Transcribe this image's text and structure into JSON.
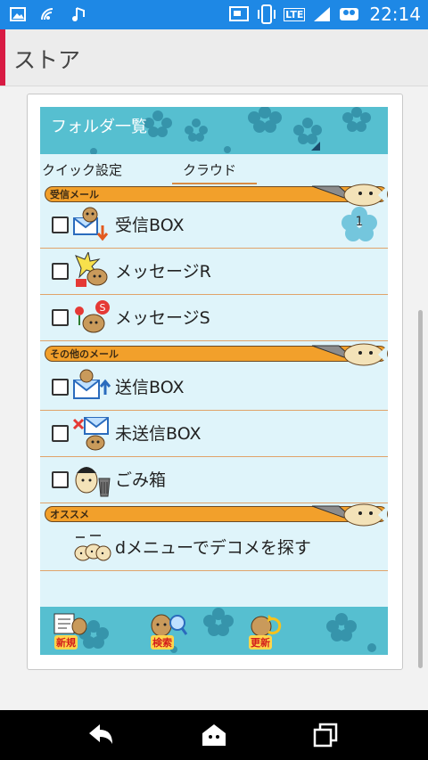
{
  "status_bar": {
    "time": "22:14",
    "network": "LTE"
  },
  "app_bar": {
    "title": "ストア"
  },
  "panel": {
    "header_title": "フォルダ一覧",
    "tabs": [
      {
        "label": "クイック設定"
      },
      {
        "label": "クラウド"
      }
    ],
    "sections": [
      {
        "label": "受信メール"
      },
      {
        "label": "その他のメール"
      },
      {
        "label": "オススメ"
      }
    ],
    "inbox_items": [
      {
        "label": "受信BOX",
        "badge": "1",
        "icon": "inbox-mascot-icon"
      },
      {
        "label": "メッセージR",
        "icon": "message-r-mascot-icon"
      },
      {
        "label": "メッセージS",
        "icon": "message-s-mascot-icon"
      }
    ],
    "other_items": [
      {
        "label": "送信BOX",
        "icon": "outbox-mascot-icon"
      },
      {
        "label": "未送信BOX",
        "icon": "unsent-mascot-icon"
      },
      {
        "label": "ごみ箱",
        "icon": "trash-mascot-icon"
      }
    ],
    "recommend_item": {
      "label": "dメニューでデコメを探す",
      "icon": "deco-mascot-icon"
    },
    "footer_buttons": [
      {
        "label": "新規",
        "icon": "new-mail-icon"
      },
      {
        "label": "検索",
        "icon": "search-mascot-icon"
      },
      {
        "label": "更新",
        "icon": "refresh-mascot-icon"
      }
    ]
  },
  "colors": {
    "header": "#56bfd0",
    "panel_bg": "#dff4fa",
    "section": "#f2a02b",
    "accent": "#d81b43",
    "statusbar": "#1e88e5"
  }
}
